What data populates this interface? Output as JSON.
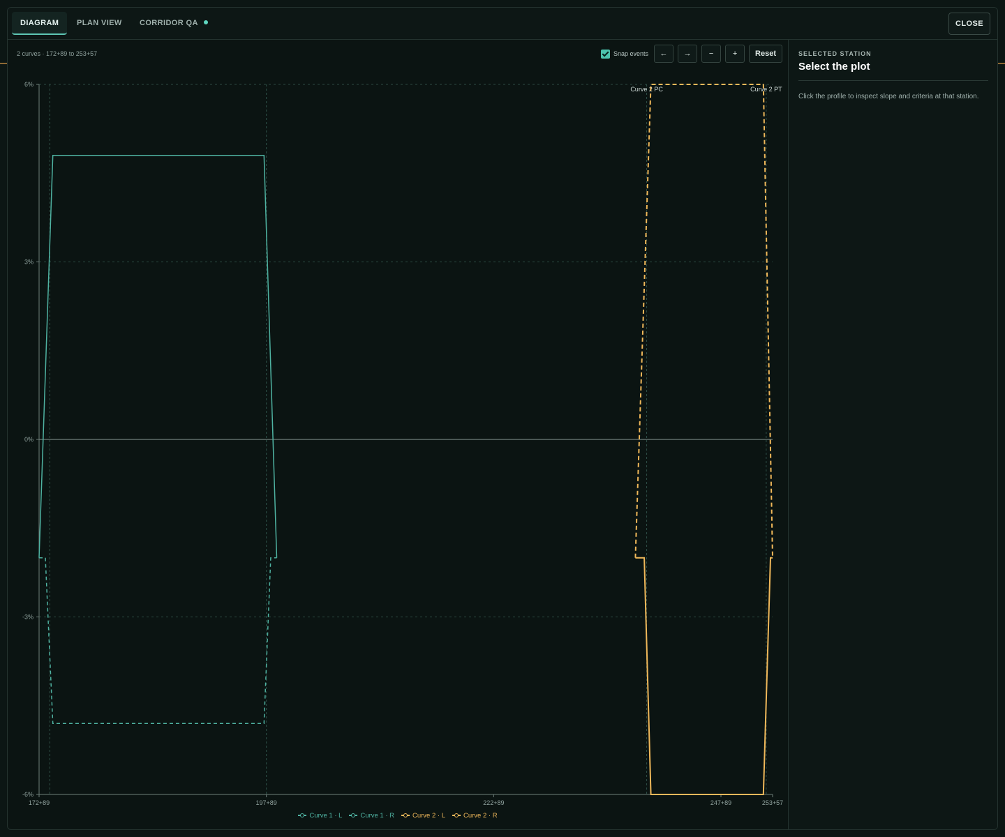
{
  "tabs": [
    {
      "label": "DIAGRAM",
      "active": true
    },
    {
      "label": "PLAN VIEW",
      "active": false
    },
    {
      "label": "CORRIDOR QA",
      "active": false
    }
  ],
  "close_label": "CLOSE",
  "summary": "2 curves · 172+89 to 253+57",
  "controls": {
    "snap_label": "Snap events",
    "snap_checked": true,
    "prev_label": "←",
    "next_label": "→",
    "zoom_out_label": "−",
    "zoom_in_label": "+",
    "reset_label": "Reset"
  },
  "side_panel": {
    "kicker": "SELECTED STATION",
    "title": "Select the plot",
    "text": "Click the profile to inspect slope and criteria at that station."
  },
  "colors": {
    "curve1": "#4fb3a2",
    "curve2": "#f0b85a",
    "accent": "#5fd7c0"
  },
  "chart_data": {
    "type": "line",
    "title": "",
    "xlabel": "",
    "ylabel": "",
    "x_unit": "station (ft)",
    "xlim": [
      17289,
      25357
    ],
    "ylim": [
      -6,
      6
    ],
    "y_ticks": [
      {
        "value": 6,
        "label": "6%"
      },
      {
        "value": 3,
        "label": "3%"
      },
      {
        "value": 0,
        "label": "0%"
      },
      {
        "value": -3,
        "label": "-3%"
      },
      {
        "value": -6,
        "label": "-6%"
      }
    ],
    "x_ticks": [
      {
        "value": 17289,
        "label": "172+89"
      },
      {
        "value": 19789,
        "label": "197+89"
      },
      {
        "value": 22289,
        "label": "222+89"
      },
      {
        "value": 24789,
        "label": "247+89"
      },
      {
        "value": 25357,
        "label": "253+57"
      }
    ],
    "grid": true,
    "legend_position": "bottom",
    "event_lines": [
      {
        "x": 17407,
        "label": ""
      },
      {
        "x": 19789,
        "label": ""
      },
      {
        "x": 23972,
        "label": "Curve 2 PC"
      },
      {
        "x": 25287,
        "label": "Curve 2 PT"
      }
    ],
    "series": [
      {
        "name": "Curve 1 · L",
        "color": "#4fb3a2",
        "dash": false,
        "width": 1.5,
        "points": [
          [
            17289,
            -2
          ],
          [
            17440,
            4.8
          ],
          [
            19763,
            4.8
          ],
          [
            19903,
            -2
          ]
        ]
      },
      {
        "name": "Curve 1 · R",
        "color": "#4fb3a2",
        "dash": true,
        "width": 1.5,
        "points": [
          [
            17289,
            -2
          ],
          [
            17358,
            -2
          ],
          [
            17440,
            -4.8
          ],
          [
            19763,
            -4.8
          ],
          [
            19837,
            -2
          ],
          [
            19903,
            -2
          ]
        ]
      },
      {
        "name": "Curve 2 · L",
        "color": "#f0b85a",
        "dash": false,
        "width": 2,
        "points": [
          [
            23848,
            -2
          ],
          [
            23945,
            -2
          ],
          [
            24018,
            -6
          ],
          [
            25256,
            -6
          ],
          [
            25334,
            -2
          ],
          [
            25357,
            -2
          ]
        ]
      },
      {
        "name": "Curve 2 · R",
        "color": "#f0b85a",
        "dash": true,
        "width": 2,
        "points": [
          [
            23848,
            -2
          ],
          [
            24018,
            6
          ],
          [
            25256,
            6
          ],
          [
            25357,
            -2
          ]
        ]
      }
    ]
  }
}
